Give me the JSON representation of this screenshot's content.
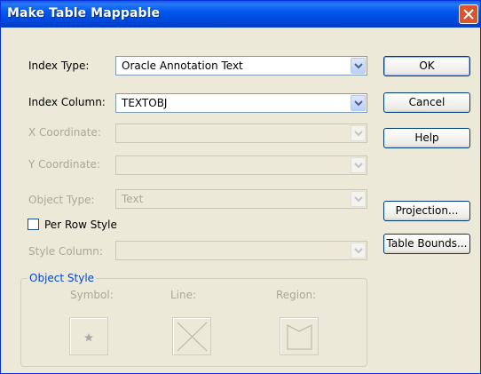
{
  "window": {
    "title": "Make Table Mappable"
  },
  "fields": {
    "index_type": {
      "label": "Index Type:",
      "value": "Oracle Annotation Text"
    },
    "index_column": {
      "label": "Index Column:",
      "value": "TEXTOBJ"
    },
    "x_coordinate": {
      "label": "X Coordinate:",
      "value": ""
    },
    "y_coordinate": {
      "label": "Y Coordinate:",
      "value": ""
    },
    "object_type": {
      "label": "Object Type:",
      "value": "Text"
    },
    "per_row_style": {
      "label": "Per Row Style",
      "checked": false
    },
    "style_column": {
      "label": "Style Column:",
      "value": ""
    }
  },
  "buttons": {
    "ok": "OK",
    "cancel": "Cancel",
    "help": "Help",
    "projection": "Projection...",
    "table_bounds": "Table Bounds..."
  },
  "object_style": {
    "title": "Object Style",
    "symbol_label": "Symbol:",
    "line_label": "Line:",
    "region_label": "Region:"
  },
  "colors": {
    "title_bar": "#0058ee",
    "dialog_bg": "#ece9d8",
    "close_button": "#d8552d",
    "group_title": "#0046d5",
    "disabled_text": "#aca899"
  },
  "icons": {
    "close": "close-icon",
    "dropdown": "chevron-down-icon",
    "symbol": "star-symbol-icon",
    "line": "line-style-icon",
    "region": "region-style-icon"
  }
}
